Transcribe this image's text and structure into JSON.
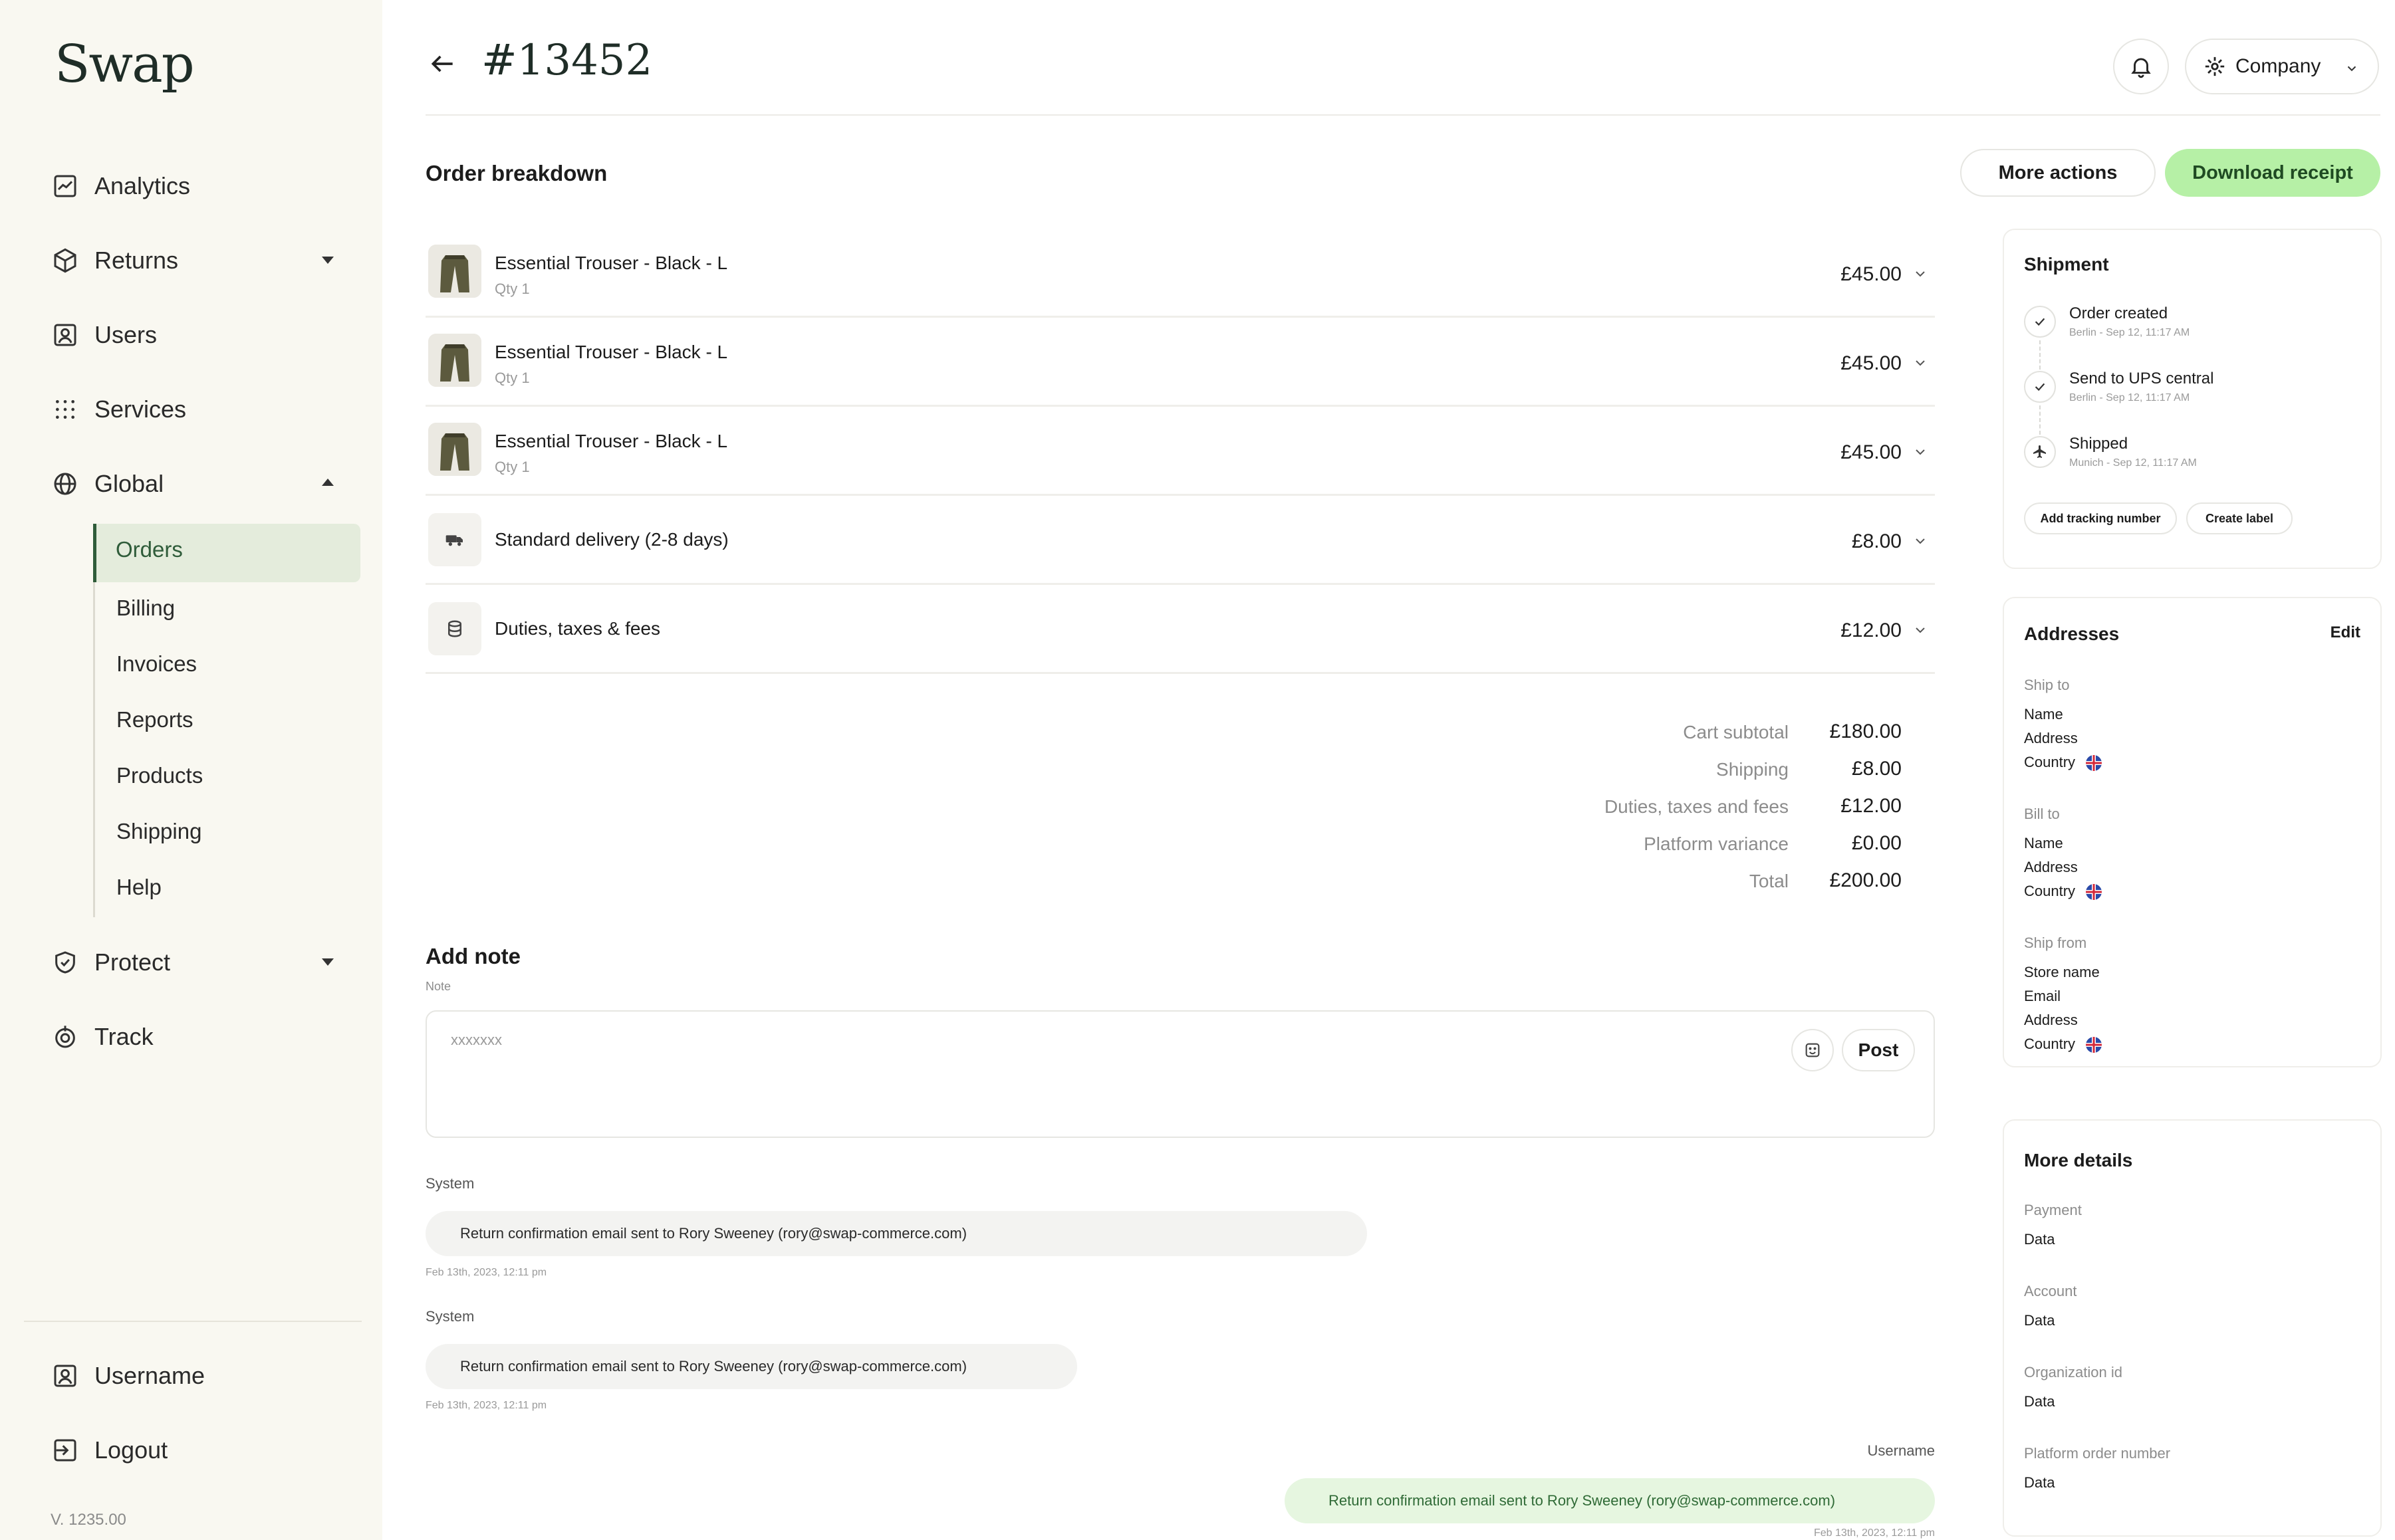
{
  "sidebar": {
    "logo": "Swap",
    "nav": [
      {
        "label": "Analytics",
        "icon": "chart-icon"
      },
      {
        "label": "Returns",
        "icon": "box-icon"
      },
      {
        "label": "Users",
        "icon": "user-square-icon"
      },
      {
        "label": "Services",
        "icon": "grid-dots-icon"
      },
      {
        "label": "Global",
        "icon": "globe-icon"
      }
    ],
    "subnav": [
      "Orders",
      "Billing",
      "Invoices",
      "Reports",
      "Products",
      "Shipping",
      "Help"
    ],
    "nav_bottom": [
      {
        "label": "Protect",
        "icon": "shield-icon"
      },
      {
        "label": "Track",
        "icon": "tracking-icon"
      }
    ],
    "account": [
      {
        "label": "Username",
        "icon": "user-square-icon"
      },
      {
        "label": "Logout",
        "icon": "logout-icon"
      }
    ],
    "version": "V. 1235.00"
  },
  "header": {
    "order_id": "#13452",
    "company_label": "Company",
    "icons": [
      "back-arrow-icon",
      "bell-icon",
      "gear-icon",
      "chevron-down-icon"
    ]
  },
  "breakdown": {
    "title": "Order breakdown",
    "more_actions": "More actions",
    "download_receipt": "Download receipt",
    "items": [
      {
        "name": "Essential Trouser - Black - L",
        "qty": "Qty 1",
        "price": "£45.00"
      },
      {
        "name": "Essential Trouser - Black - L",
        "qty": "Qty 1",
        "price": "£45.00"
      },
      {
        "name": "Essential Trouser - Black - L",
        "qty": "Qty 1",
        "price": "£45.00"
      }
    ],
    "delivery": {
      "label": "Standard delivery (2-8 days)",
      "price": "£8.00",
      "icon": "truck-icon"
    },
    "duties": {
      "label": "Duties, taxes & fees",
      "price": "£12.00",
      "icon": "coins-icon"
    },
    "summary": [
      {
        "label": "Cart subtotal",
        "value": "£180.00"
      },
      {
        "label": "Shipping",
        "value": "£8.00"
      },
      {
        "label": "Duties, taxes and fees",
        "value": "£12.00"
      },
      {
        "label": "Platform variance",
        "value": "£0.00"
      },
      {
        "label": "Total",
        "value": "£200.00"
      }
    ]
  },
  "note": {
    "title": "Add note",
    "label": "Note",
    "placeholder": "xxxxxxx",
    "post": "Post"
  },
  "messages": [
    {
      "author": "System",
      "text": "Return confirmation email sent to Rory Sweeney (rory@swap-commerce.com)",
      "time": "Feb 13th, 2023, 12:11 pm"
    },
    {
      "author": "System",
      "text": "Return confirmation email sent to Rory Sweeney (rory@swap-commerce.com)",
      "time": "Feb 13th, 2023, 12:11 pm"
    },
    {
      "author": "Username",
      "text": "Return confirmation email sent to Rory Sweeney (rory@swap-commerce.com)",
      "time": "Feb 13th, 2023, 12:11 pm"
    }
  ],
  "shipment": {
    "title": "Shipment",
    "steps": [
      {
        "title": "Order created",
        "sub": "Berlin - Sep 12, 11:17 AM",
        "icon": "check-icon"
      },
      {
        "title": "Send to UPS central",
        "sub": "Berlin - Sep 12, 11:17 AM",
        "icon": "check-icon"
      },
      {
        "title": "Shipped",
        "sub": "Munich - Sep 12, 11:17 AM",
        "icon": "plane-icon"
      }
    ],
    "add_tracking": "Add tracking number",
    "create_label": "Create label"
  },
  "addresses": {
    "title": "Addresses",
    "edit": "Edit",
    "groups": [
      {
        "label": "Ship to",
        "lines": [
          "Name",
          "Address",
          "Country"
        ]
      },
      {
        "label": "Bill to",
        "lines": [
          "Name",
          "Address",
          "Country"
        ]
      },
      {
        "label": "Ship from",
        "lines": [
          "Store name",
          "Email",
          "Address",
          "Country"
        ]
      }
    ]
  },
  "more_details": {
    "title": "More details",
    "fields": [
      {
        "label": "Payment",
        "value": "Data"
      },
      {
        "label": "Account",
        "value": "Data"
      },
      {
        "label": "Organization id",
        "value": "Data"
      },
      {
        "label": "Platform order number",
        "value": "Data"
      }
    ]
  },
  "colors": {
    "accent_green": "#b6f0a6",
    "nav_active_bg": "#e4ecdc",
    "nav_active_text": "#2f5c3a",
    "sidebar_bg": "#f9f8f1"
  }
}
